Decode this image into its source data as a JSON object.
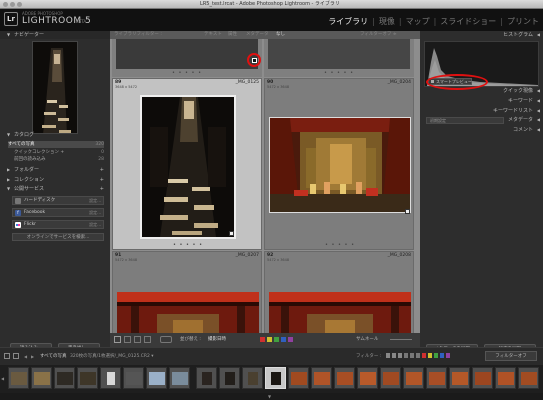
{
  "window": {
    "title": "LR5_test.lrcat - Adobe Photoshop Lightroom - ライブラリ"
  },
  "identity": {
    "vendor": "ADOBE PHOTOSHOP",
    "product": "LIGHTROOM 5",
    "edition": "BETA",
    "logo": "Lr"
  },
  "modules": {
    "items": [
      "ライブラリ",
      "現像",
      "マップ",
      "スライドショー",
      "プリント"
    ],
    "active": "ライブラリ"
  },
  "left_panel": {
    "navigator": {
      "title": "ナビゲーター",
      "zoom_labels": [
        "全体",
        "画面",
        "1:1",
        "3:1"
      ]
    },
    "catalog": {
      "title": "カタログ",
      "items": [
        {
          "label": "すべての写真",
          "count": "320"
        },
        {
          "label": "クイックコレクション +",
          "count": "0"
        },
        {
          "label": "前回の読み込み",
          "count": "28"
        }
      ]
    },
    "folders": {
      "title": "フォルダー"
    },
    "collections": {
      "title": "コレクション"
    },
    "publish": {
      "title": "公開サービス",
      "services": [
        {
          "label": "ハードディスク",
          "status": "設定..."
        },
        {
          "label": "Facebook",
          "status": "設定..."
        },
        {
          "label": "Flickr",
          "status": "設定..."
        }
      ],
      "find_more": "オンラインでサービスを検索..."
    },
    "import_button": "読み込み...",
    "export_button": "書き出し..."
  },
  "filter_bar": {
    "label": "ライブラリフィルター :",
    "options": [
      "テキスト",
      "属性",
      "メタデータ",
      "なし"
    ],
    "preset": "フィルターオフ ≑"
  },
  "grid": {
    "cells": [
      {
        "num": "89",
        "file": "_MG_0125",
        "dims": "3648 x 5472",
        "selected": true
      },
      {
        "num": "90",
        "file": "_MG_0204",
        "dims": "5472 x 3648",
        "selected": false
      },
      {
        "num": "91",
        "file": "_MG_0207",
        "dims": "5472 x 3648",
        "selected": false
      },
      {
        "num": "92",
        "file": "_MG_0208",
        "dims": "5472 x 3648",
        "selected": false
      }
    ]
  },
  "toolbar": {
    "sort_label": "並び替え :",
    "sort_value": "撮影日時",
    "thumbnail_label": "サムネール"
  },
  "right_panel": {
    "histogram": {
      "title": "ヒストグラム"
    },
    "smart_preview": {
      "label": "スマートプレビュー"
    },
    "sections": [
      {
        "title": "クイック現像"
      },
      {
        "title": "キーワード"
      },
      {
        "title": "キーワードリスト"
      },
      {
        "title": "メタデータ"
      },
      {
        "title": "コメント"
      }
    ],
    "preset_label": "初期設定",
    "sync_metadata": "メタデータを同期",
    "sync_settings": "設定を同期"
  },
  "filmstrip_header": {
    "source": "すべての写真",
    "info": "320枚の写真/1枚選択/_MG_0125.CR2 ▾",
    "filter_label": "フィルター :",
    "filter_value": "フィルターオフ"
  },
  "annotation": {
    "color": "#e01010"
  }
}
